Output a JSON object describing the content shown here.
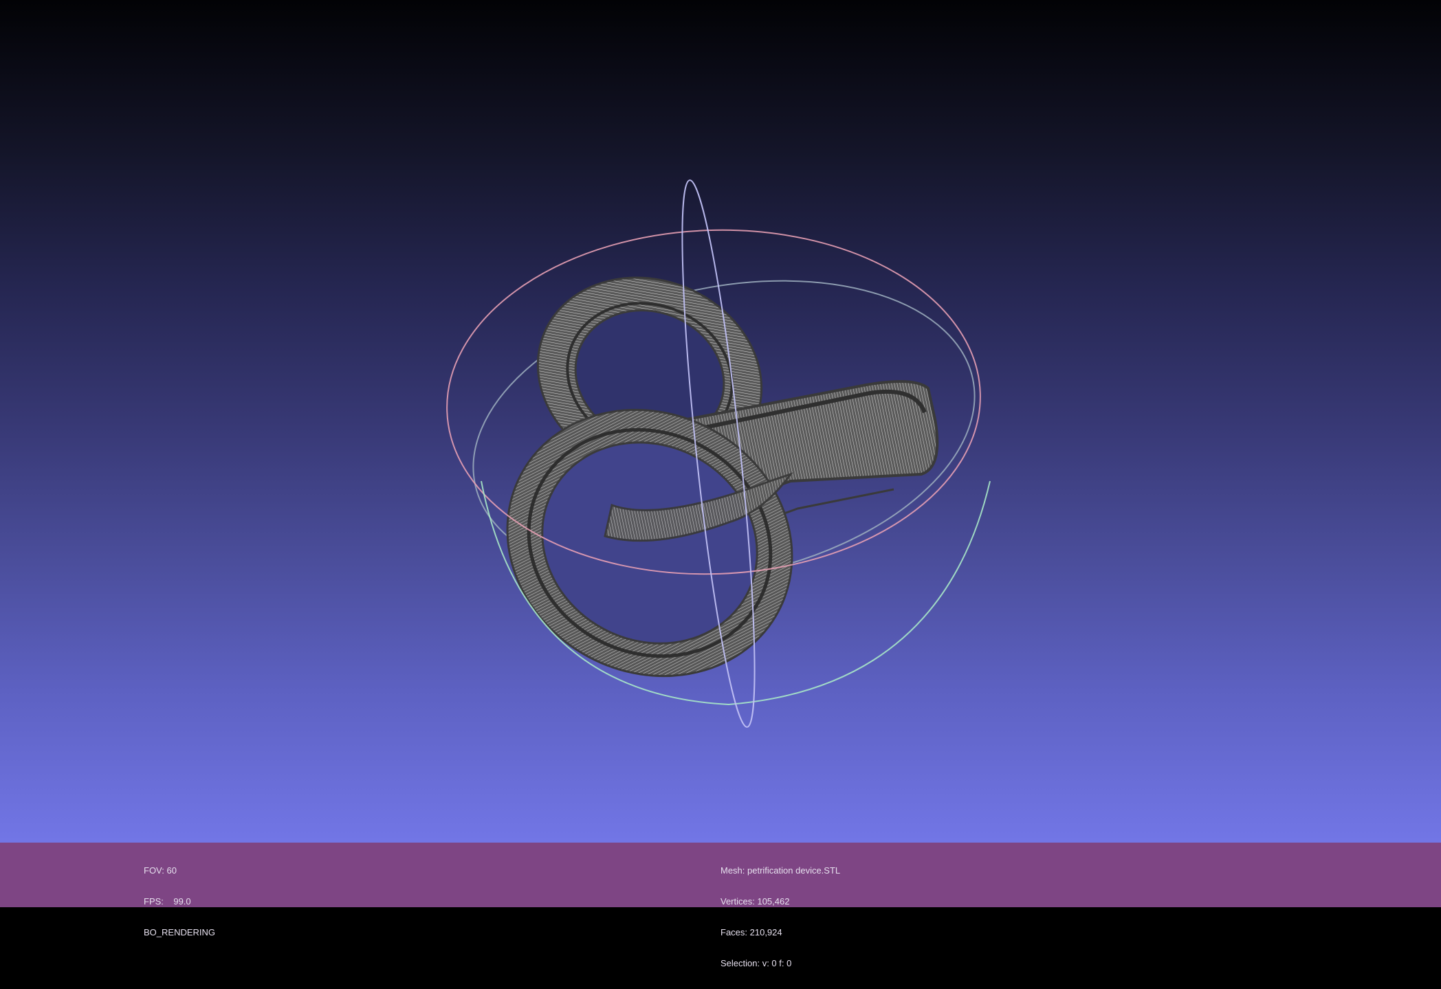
{
  "viewport": {
    "background_top": "#020205",
    "background_bottom": "#7276e6",
    "model": {
      "name": "interlocked-rings-mesh",
      "color": "#6a6a6a",
      "wire_color": "#d8d8d8"
    },
    "trackball": {
      "x_ring_color": "#e7a0b4",
      "y_ring_color": "#a8e8c8",
      "z_ring_color": "#b8b8f4"
    }
  },
  "status_left": {
    "fov": "FOV: 60",
    "fps": "FPS:    99.0",
    "mode": "BO_RENDERING"
  },
  "status_right": {
    "mesh": "Mesh: petrification device.STL",
    "vertices": "Vertices: 105,462",
    "faces": "Faces: 210,924",
    "selection": "Selection: v: 0 f: 0"
  },
  "info_bar": {
    "color": "#7e4584"
  }
}
